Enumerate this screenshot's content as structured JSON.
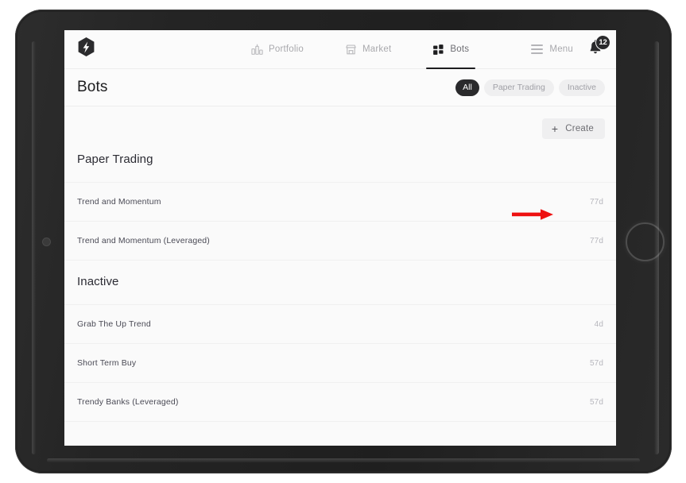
{
  "app": {
    "logo_icon": "lightning-hex-logo"
  },
  "topnav": {
    "items": [
      {
        "label": "Portfolio",
        "icon": "bar-chart-icon",
        "active": false
      },
      {
        "label": "Market",
        "icon": "storefront-icon",
        "active": false
      },
      {
        "label": "Bots",
        "icon": "grid-squares-icon",
        "active": true
      }
    ],
    "menu": {
      "label": "Menu",
      "icon": "hamburger-icon"
    },
    "notifications": {
      "icon": "bell-icon",
      "badge_count": "12"
    }
  },
  "header": {
    "title": "Bots",
    "filters": [
      {
        "label": "All",
        "selected": true
      },
      {
        "label": "Paper Trading",
        "selected": false
      },
      {
        "label": "Inactive",
        "selected": false
      }
    ]
  },
  "toolbar": {
    "create_label": "Create",
    "create_icon": "plus-icon"
  },
  "annotation": {
    "type": "arrow",
    "color": "#ee1111",
    "points_to": "create-button"
  },
  "sections": [
    {
      "title": "Paper Trading",
      "rows": [
        {
          "name": "Trend and Momentum",
          "meta": "77d"
        },
        {
          "name": "Trend and Momentum (Leveraged)",
          "meta": "77d"
        }
      ]
    },
    {
      "title": "Inactive",
      "rows": [
        {
          "name": "Grab The Up Trend",
          "meta": "4d"
        },
        {
          "name": "Short Term Buy",
          "meta": "57d"
        },
        {
          "name": "Trendy Banks (Leveraged)",
          "meta": "57d"
        }
      ]
    }
  ],
  "colors": {
    "accent_dark": "#2a2a2c",
    "chip_bg": "#efeff0",
    "annotation_red": "#ee1111"
  }
}
